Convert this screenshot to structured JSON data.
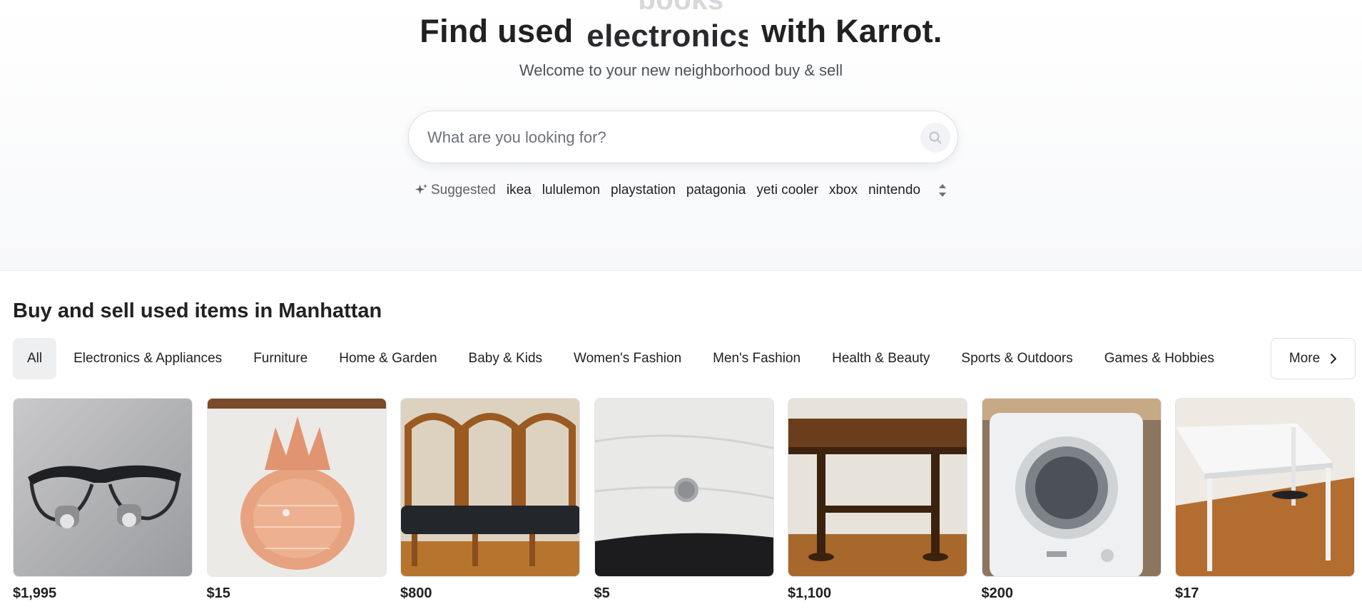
{
  "hero": {
    "rotating_word_prev": "books",
    "headline_prefix": "Find used",
    "rotating_word": "electronics",
    "headline_suffix": "with Karrot.",
    "subtitle": "Welcome to your new neighborhood buy & sell"
  },
  "search": {
    "placeholder": "What are you looking for?",
    "value": "",
    "icon": "search-icon"
  },
  "suggested": {
    "label": "Suggested",
    "icon": "sparkle-icon",
    "keywords": [
      "ikea",
      "lululemon",
      "playstation",
      "patagonia",
      "yeti cooler",
      "xbox",
      "nintendo"
    ]
  },
  "listings": {
    "title": "Buy and sell used items in Manhattan",
    "categories": [
      "All",
      "Electronics & Appliances",
      "Furniture",
      "Home & Garden",
      "Baby & Kids",
      "Women's Fashion",
      "Men's Fashion",
      "Health & Beauty",
      "Sports & Outdoors",
      "Games & Hobbies"
    ],
    "active_category": "All",
    "more_label": "More",
    "items": [
      {
        "price": "$1,995",
        "image": "loupe glasses"
      },
      {
        "price": "$15",
        "image": "pink glass pineapple jar"
      },
      {
        "price": "$800",
        "image": "wooden chairs"
      },
      {
        "price": "$5",
        "image": "coin on wall"
      },
      {
        "price": "$1,100",
        "image": "wooden table"
      },
      {
        "price": "$200",
        "image": "compact dryer"
      },
      {
        "price": "$17",
        "image": "white desk"
      }
    ]
  },
  "colors": {
    "text": "#212124",
    "muted": "#4d5159",
    "chip_active_bg": "#eeeff1",
    "hero_bg": "#f7f8fa"
  }
}
